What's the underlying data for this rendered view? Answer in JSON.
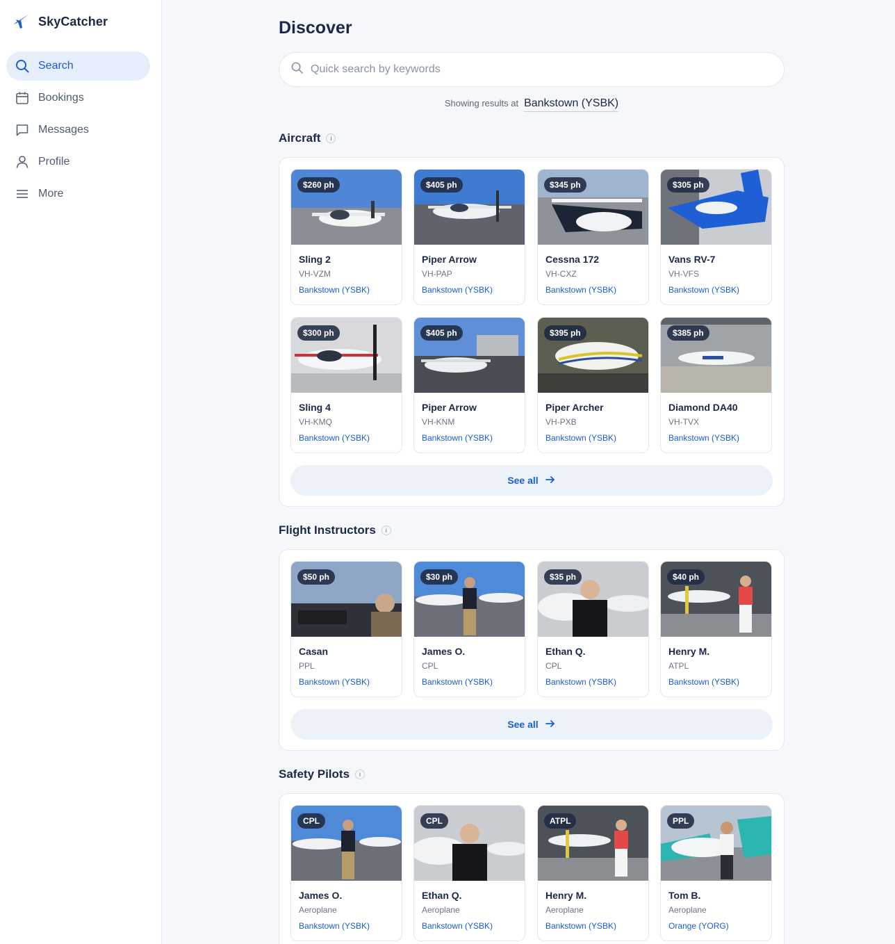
{
  "app": {
    "name": "SkyCatcher"
  },
  "nav": [
    {
      "label": "Search",
      "icon": "search-icon",
      "active": true
    },
    {
      "label": "Bookings",
      "icon": "calendar-icon"
    },
    {
      "label": "Messages",
      "icon": "message-icon"
    },
    {
      "label": "Profile",
      "icon": "user-icon"
    },
    {
      "label": "More",
      "icon": "menu-icon"
    }
  ],
  "page": {
    "title": "Discover"
  },
  "search": {
    "placeholder": "Quick search by keywords",
    "value": ""
  },
  "location": {
    "prefix": "Showing results at",
    "value": "Bankstown (YSBK)"
  },
  "colors": {
    "accent": "#1a5cd6",
    "active_bg": "#e6eefc",
    "badge_bg": "#202a42"
  },
  "sections": {
    "aircraft": {
      "title": "Aircraft",
      "see_all": "See all",
      "items": [
        {
          "price": "$260 ph",
          "name": "Sling 2",
          "sub": "VH-VZM",
          "location": "Bankstown (YSBK)"
        },
        {
          "price": "$405 ph",
          "name": "Piper Arrow",
          "sub": "VH-PAP",
          "location": "Bankstown (YSBK)"
        },
        {
          "price": "$345 ph",
          "name": "Cessna 172",
          "sub": "VH-CXZ",
          "location": "Bankstown (YSBK)"
        },
        {
          "price": "$305 ph",
          "name": "Vans RV-7",
          "sub": "VH-VFS",
          "location": "Bankstown (YSBK)"
        },
        {
          "price": "$300 ph",
          "name": "Sling 4",
          "sub": "VH-KMQ",
          "location": "Bankstown (YSBK)"
        },
        {
          "price": "$405 ph",
          "name": "Piper Arrow",
          "sub": "VH-KNM",
          "location": "Bankstown (YSBK)"
        },
        {
          "price": "$395 ph",
          "name": "Piper Archer",
          "sub": "VH-PXB",
          "location": "Bankstown (YSBK)"
        },
        {
          "price": "$385 ph",
          "name": "Diamond DA40",
          "sub": "VH-TVX",
          "location": "Bankstown (YSBK)"
        }
      ]
    },
    "instructors": {
      "title": "Flight Instructors",
      "see_all": "See all",
      "items": [
        {
          "price": "$50 ph",
          "name": "Casan",
          "sub": "PPL",
          "location": "Bankstown (YSBK)"
        },
        {
          "price": "$30 ph",
          "name": "James O.",
          "sub": "CPL",
          "location": "Bankstown (YSBK)"
        },
        {
          "price": "$35 ph",
          "name": "Ethan Q.",
          "sub": "CPL",
          "location": "Bankstown (YSBK)"
        },
        {
          "price": "$40 ph",
          "name": "Henry M.",
          "sub": "ATPL",
          "location": "Bankstown (YSBK)"
        }
      ]
    },
    "safety_pilots": {
      "title": "Safety Pilots",
      "items": [
        {
          "price": "CPL",
          "name": "James O.",
          "sub": "Aeroplane",
          "location": "Bankstown (YSBK)"
        },
        {
          "price": "CPL",
          "name": "Ethan Q.",
          "sub": "Aeroplane",
          "location": "Bankstown (YSBK)"
        },
        {
          "price": "ATPL",
          "name": "Henry M.",
          "sub": "Aeroplane",
          "location": "Bankstown (YSBK)"
        },
        {
          "price": "PPL",
          "name": "Tom B.",
          "sub": "Aeroplane",
          "location": "Orange (YORG)"
        }
      ]
    }
  }
}
